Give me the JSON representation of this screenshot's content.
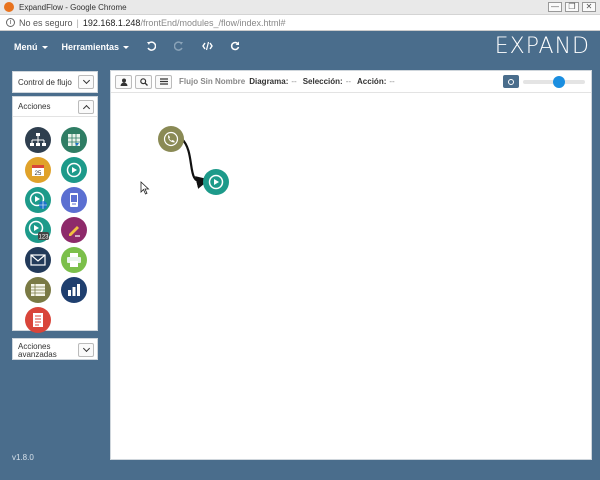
{
  "window": {
    "title": "ExpandFlow - Google Chrome",
    "controls": [
      "—",
      "❐",
      "✕"
    ]
  },
  "address": {
    "insecure_label": "No es seguro",
    "separator": "|",
    "host": "192.168.1.248",
    "path": "/frontEnd/modules_/flow/index.html#"
  },
  "appbar": {
    "menu_label": "Menú",
    "tools_label": "Herramientas",
    "brand": "EXPAND",
    "tool_icons": [
      "undo-icon",
      "redo-icon",
      "code-icon",
      "refresh-icon"
    ]
  },
  "sidebar": {
    "flow_control_label": "Control de flujo",
    "actions_label": "Acciones",
    "advanced_actions_label": "Acciones avanzadas",
    "version": "v1.8.0",
    "actions": [
      {
        "name": "hierarchy",
        "color": "#2f3f4f"
      },
      {
        "name": "spreadsheet-import",
        "color": "#2f7d64"
      },
      {
        "name": "calendar",
        "color": "#e0a22a",
        "text": "25"
      },
      {
        "name": "play",
        "color": "#1d9a8a"
      },
      {
        "name": "play-web",
        "color": "#1d9a8a"
      },
      {
        "name": "mobile",
        "color": "#5b6fd1"
      },
      {
        "name": "play-number",
        "color": "#1d9a8a",
        "text": "123"
      },
      {
        "name": "edit",
        "color": "#8e2a6a"
      },
      {
        "name": "email",
        "color": "#223a5a"
      },
      {
        "name": "print",
        "color": "#7bbf4a"
      },
      {
        "name": "table",
        "color": "#7a7a44"
      },
      {
        "name": "bar-chart",
        "color": "#1f3f6f"
      },
      {
        "name": "document",
        "color": "#d9453a"
      }
    ]
  },
  "toolbar": {
    "flow_name": "Flujo Sin Nombre",
    "diagram_label": "Diagrama:",
    "diagram_value": "--",
    "selection_label": "Selección:",
    "selection_value": "--",
    "action_label": "Acción:",
    "action_value": "--",
    "zoom_level": 0.6
  },
  "canvas": {
    "nodes": [
      {
        "name": "phone-node",
        "color": "#8a8a55"
      },
      {
        "name": "play-node",
        "color": "#1d9a8a"
      }
    ]
  }
}
